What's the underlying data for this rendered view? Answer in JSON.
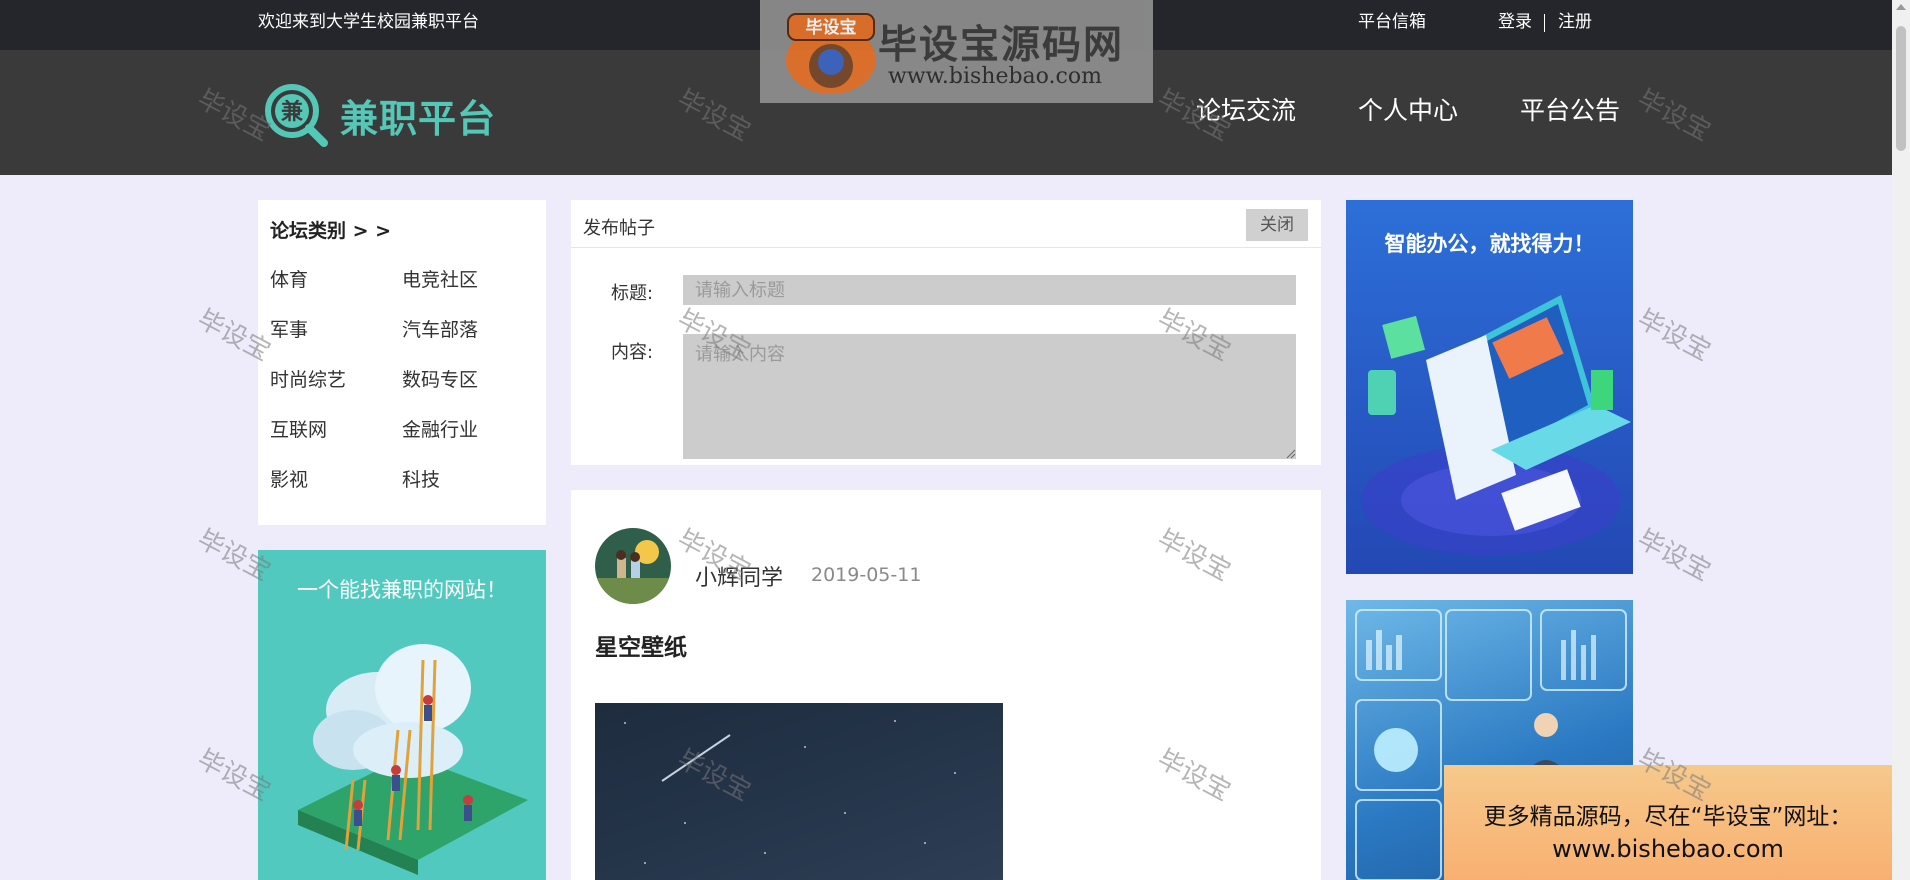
{
  "topbar": {
    "welcome": "欢迎来到大学生校园兼职平台",
    "inbox": "平台信箱",
    "login": "登录",
    "register": "注册"
  },
  "header": {
    "logo_glyph": "兼",
    "logo_text": "兼职平台",
    "nav": [
      "论坛交流",
      "个人中心",
      "平台公告"
    ]
  },
  "watermark_banner": {
    "mascot_text": "毕设宝",
    "title": "毕设宝源码网",
    "url": "www.bishebao.com"
  },
  "watermark_stamp": "毕设宝",
  "categories": {
    "title": "论坛类别 > >",
    "items": [
      "体育",
      "电竞社区",
      "军事",
      "汽车部落",
      "时尚综艺",
      "数码专区",
      "互联网",
      "金融行业",
      "影视",
      "科技"
    ]
  },
  "ad_left": {
    "text": "一个能找兼职的网站！"
  },
  "post_form": {
    "title": "发布帖子",
    "close_label": "关闭",
    "title_label": "标题:",
    "title_placeholder": "请输入标题",
    "content_label": "内容:",
    "content_placeholder": "请输入内容"
  },
  "post": {
    "author": "小辉同学",
    "date": "2019-05-11",
    "title": "星空壁纸"
  },
  "ad_right1": {
    "text": "智能办公，就找得力！"
  },
  "promo": {
    "line1": "更多精品源码，尽在“毕设宝”网址：",
    "line2": "www.bishebao.com"
  },
  "colors": {
    "topbar": "#24262b",
    "header": "#3a3a3a",
    "brand": "#54c7b6",
    "page_bg": "#eeecfb"
  }
}
